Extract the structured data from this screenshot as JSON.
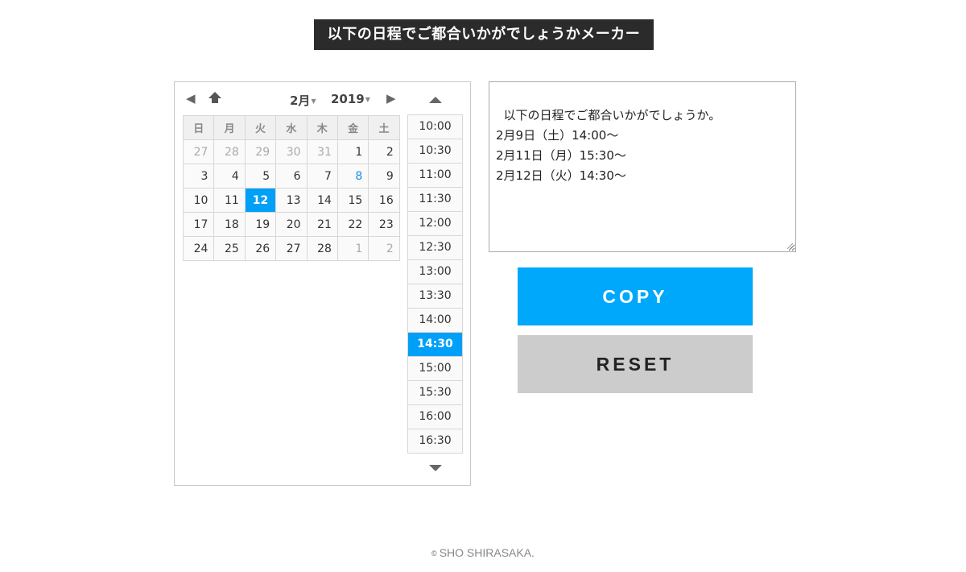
{
  "page": {
    "title": "以下の日程でご都合いかがでしょうかメーカー"
  },
  "calendar": {
    "month_label": "2月",
    "year_label": "2019",
    "weekdays": [
      "日",
      "月",
      "火",
      "水",
      "木",
      "金",
      "土"
    ],
    "weeks": [
      [
        {
          "d": "27",
          "cls": "other"
        },
        {
          "d": "28",
          "cls": "other"
        },
        {
          "d": "29",
          "cls": "other"
        },
        {
          "d": "30",
          "cls": "other"
        },
        {
          "d": "31",
          "cls": "other"
        },
        {
          "d": "1",
          "cls": ""
        },
        {
          "d": "2",
          "cls": ""
        }
      ],
      [
        {
          "d": "3",
          "cls": ""
        },
        {
          "d": "4",
          "cls": ""
        },
        {
          "d": "5",
          "cls": ""
        },
        {
          "d": "6",
          "cls": ""
        },
        {
          "d": "7",
          "cls": ""
        },
        {
          "d": "8",
          "cls": "today"
        },
        {
          "d": "9",
          "cls": ""
        }
      ],
      [
        {
          "d": "10",
          "cls": ""
        },
        {
          "d": "11",
          "cls": ""
        },
        {
          "d": "12",
          "cls": "selected"
        },
        {
          "d": "13",
          "cls": ""
        },
        {
          "d": "14",
          "cls": ""
        },
        {
          "d": "15",
          "cls": ""
        },
        {
          "d": "16",
          "cls": ""
        }
      ],
      [
        {
          "d": "17",
          "cls": ""
        },
        {
          "d": "18",
          "cls": ""
        },
        {
          "d": "19",
          "cls": ""
        },
        {
          "d": "20",
          "cls": ""
        },
        {
          "d": "21",
          "cls": ""
        },
        {
          "d": "22",
          "cls": ""
        },
        {
          "d": "23",
          "cls": ""
        }
      ],
      [
        {
          "d": "24",
          "cls": ""
        },
        {
          "d": "25",
          "cls": ""
        },
        {
          "d": "26",
          "cls": ""
        },
        {
          "d": "27",
          "cls": ""
        },
        {
          "d": "28",
          "cls": ""
        },
        {
          "d": "1",
          "cls": "other"
        },
        {
          "d": "2",
          "cls": "other"
        }
      ]
    ],
    "icons": {
      "prev": "triangle-left-icon",
      "home": "home-arrow-icon",
      "next": "triangle-right-icon"
    }
  },
  "times": {
    "items": [
      "10:00",
      "10:30",
      "11:00",
      "11:30",
      "12:00",
      "12:30",
      "13:00",
      "13:30",
      "14:00",
      "14:30",
      "15:00",
      "15:30",
      "16:00",
      "16:30"
    ],
    "selected": "14:30"
  },
  "output": {
    "text": "以下の日程でご都合いかがでしょうか。\n2月9日（土）14:00〜\n2月11日（月）15:30〜\n2月12日（火）14:30〜"
  },
  "buttons": {
    "copy_label": "COPY",
    "reset_label": "RESET"
  },
  "footer": {
    "symbol": "©",
    "text": "SHO SHIRASAKA."
  },
  "colors": {
    "accent": "#00a8fb",
    "selected": "#00a0f8",
    "title_bg": "#2b2b2b",
    "reset_bg": "#cccccc"
  }
}
